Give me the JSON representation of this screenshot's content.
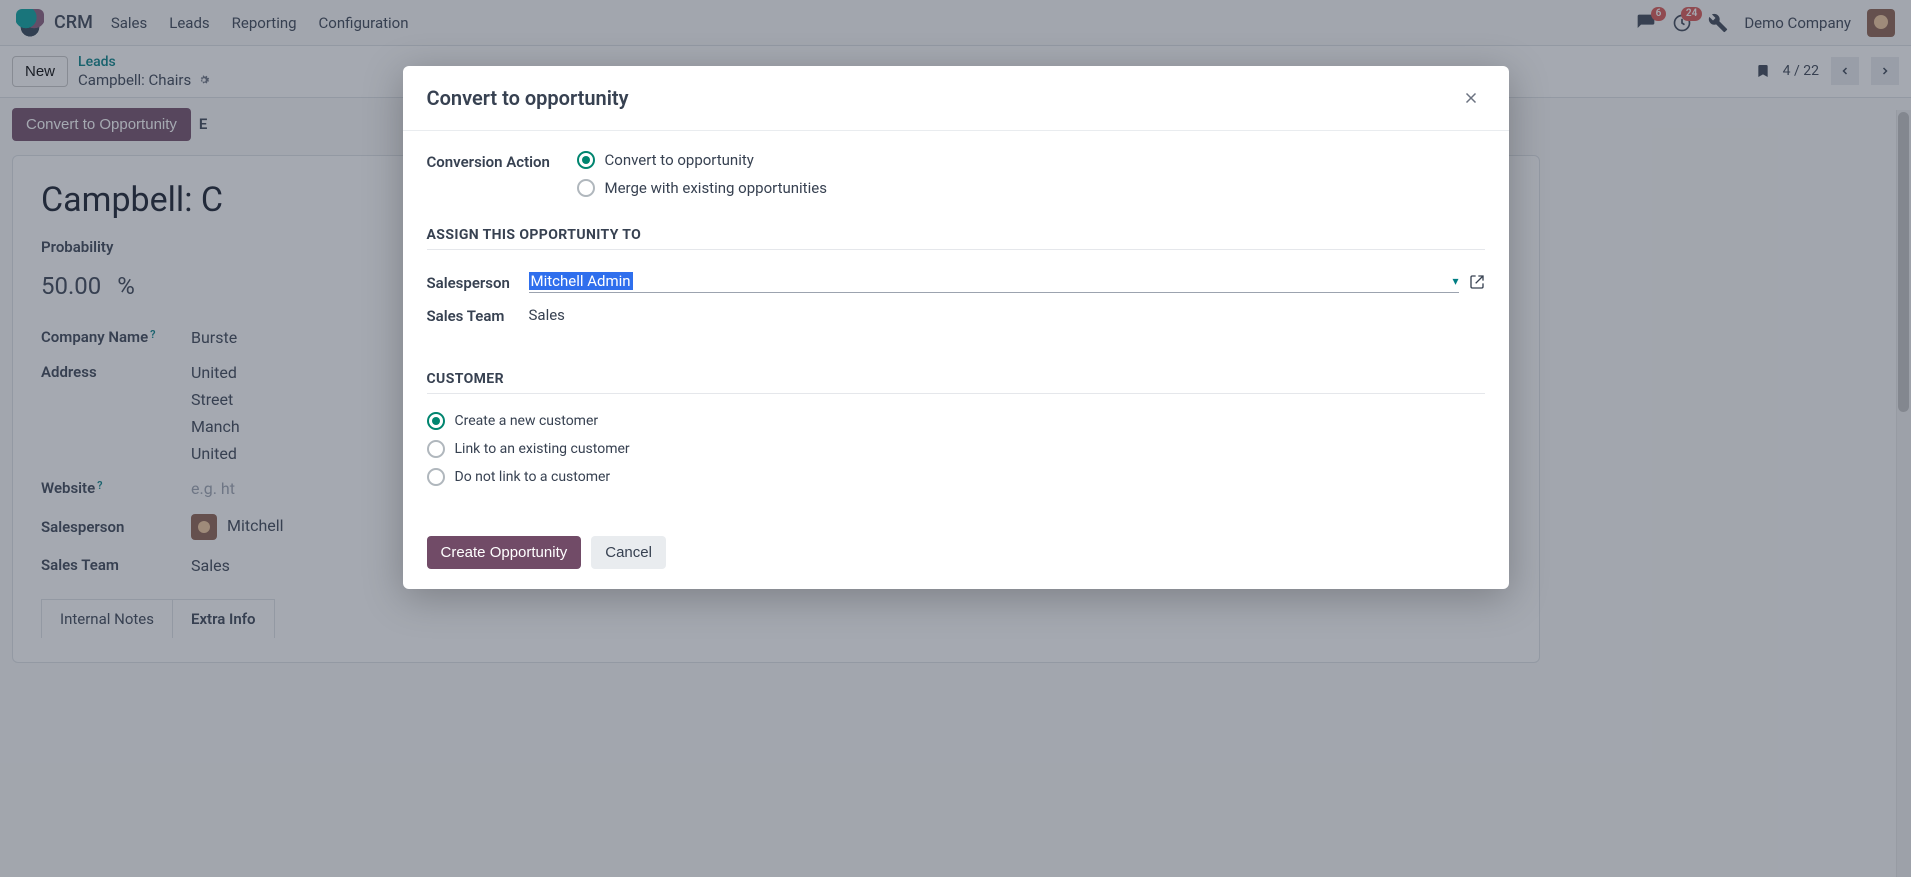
{
  "nav": {
    "app": "CRM",
    "items": [
      "Sales",
      "Leads",
      "Reporting",
      "Configuration"
    ],
    "chat_badge": "6",
    "activity_badge": "24",
    "company": "Demo Company"
  },
  "subhead": {
    "new_btn": "New",
    "parent": "Leads",
    "title": "Campbell: Chairs",
    "pager": "4 / 22"
  },
  "statusbar": {
    "convert_btn": "Convert to Opportunity",
    "e_partial": "E"
  },
  "record": {
    "title": "Campbell: C",
    "probability_label": "Probability",
    "probability_value": "50.00",
    "probability_unit": "%",
    "company_name_label": "Company Name",
    "company_name_value": "Burste",
    "address_label": "Address",
    "address_lines": [
      "United",
      "Street",
      "Manch",
      "United"
    ],
    "website_label": "Website",
    "website_placeholder": "e.g. ht",
    "salesperson_label": "Salesperson",
    "salesperson_value": "Mitchell",
    "salesteam_label": "Sales Team",
    "salesteam_value": "Sales",
    "tabs": [
      "Internal Notes",
      "Extra Info"
    ],
    "active_tab": 1
  },
  "modal": {
    "title": "Convert to opportunity",
    "conversion_label": "Conversion Action",
    "conversion_opts": [
      "Convert to opportunity",
      "Merge with existing opportunities"
    ],
    "conversion_selected": 0,
    "assign_section": "ASSIGN THIS OPPORTUNITY TO",
    "salesperson_label": "Salesperson",
    "salesperson_value": "Mitchell Admin",
    "salesteam_label": "Sales Team",
    "salesteam_value": "Sales",
    "customer_section": "CUSTOMER",
    "customer_opts": [
      "Create a new customer",
      "Link to an existing customer",
      "Do not link to a customer"
    ],
    "customer_selected": 0,
    "create_btn": "Create Opportunity",
    "cancel_btn": "Cancel"
  }
}
